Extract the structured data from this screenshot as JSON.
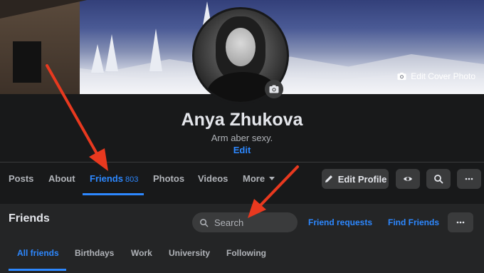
{
  "cover": {
    "edit_cover_label": "Edit Cover Photo"
  },
  "profile": {
    "name": "Anya Zhukova",
    "bio": "Arm aber sexy.",
    "bio_edit_label": "Edit"
  },
  "tabs": [
    {
      "label": "Posts"
    },
    {
      "label": "About"
    },
    {
      "label": "Friends",
      "count": "803",
      "active": true
    },
    {
      "label": "Photos"
    },
    {
      "label": "Videos"
    },
    {
      "label": "More"
    }
  ],
  "actions": {
    "edit_profile_label": "Edit Profile",
    "icons": [
      "pencil-icon",
      "eye-icon",
      "search-icon",
      "more-icon"
    ]
  },
  "friends_panel": {
    "title": "Friends",
    "search_placeholder": "Search",
    "friend_requests_label": "Friend requests",
    "find_friends_label": "Find Friends",
    "subtabs": [
      {
        "label": "All friends",
        "active": true
      },
      {
        "label": "Birthdays"
      },
      {
        "label": "Work"
      },
      {
        "label": "University"
      },
      {
        "label": "Following"
      }
    ]
  },
  "colors": {
    "background": "#18191a",
    "panel": "#242526",
    "button": "#3a3b3c",
    "accent": "#2d88ff",
    "annotation_arrow": "#e8391f"
  }
}
